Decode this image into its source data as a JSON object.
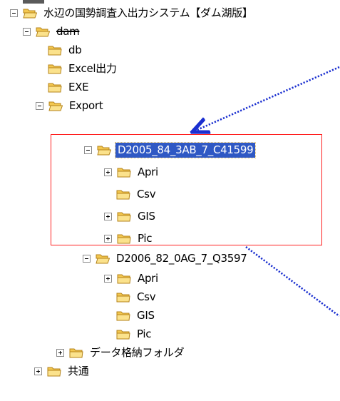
{
  "tree": {
    "root": {
      "label": "水辺の国勢調査入出力システム【ダム湖版】"
    },
    "dam": {
      "label": "dam"
    },
    "db": {
      "label": "db"
    },
    "excel": {
      "label": "Excel出力"
    },
    "exe": {
      "label": "EXE"
    },
    "export": {
      "label": "Export"
    },
    "d2005": {
      "label": "D2005_84_3AB_7_C41599"
    },
    "d2005_apri": {
      "label": "Apri"
    },
    "d2005_csv": {
      "label": "Csv"
    },
    "d2005_gis": {
      "label": "GIS"
    },
    "d2005_pic": {
      "label": "Pic"
    },
    "d2006": {
      "label": "D2006_82_0AG_7_Q3597"
    },
    "d2006_apri": {
      "label": "Apri"
    },
    "d2006_csv": {
      "label": "Csv"
    },
    "d2006_gis": {
      "label": "GIS"
    },
    "d2006_pic": {
      "label": "Pic"
    },
    "data_store": {
      "label": "データ格納フォルダ"
    },
    "common": {
      "label": "共通"
    }
  },
  "colors": {
    "selection": "#2f58c4",
    "highlight_box": "#ff2020",
    "arrow": "#1a2fd0",
    "folder_fill": "#f7d774",
    "folder_stroke": "#c58d1d"
  },
  "icons": {
    "folder": "folder-icon",
    "expand": "plus-toggle",
    "collapse": "minus-toggle"
  }
}
